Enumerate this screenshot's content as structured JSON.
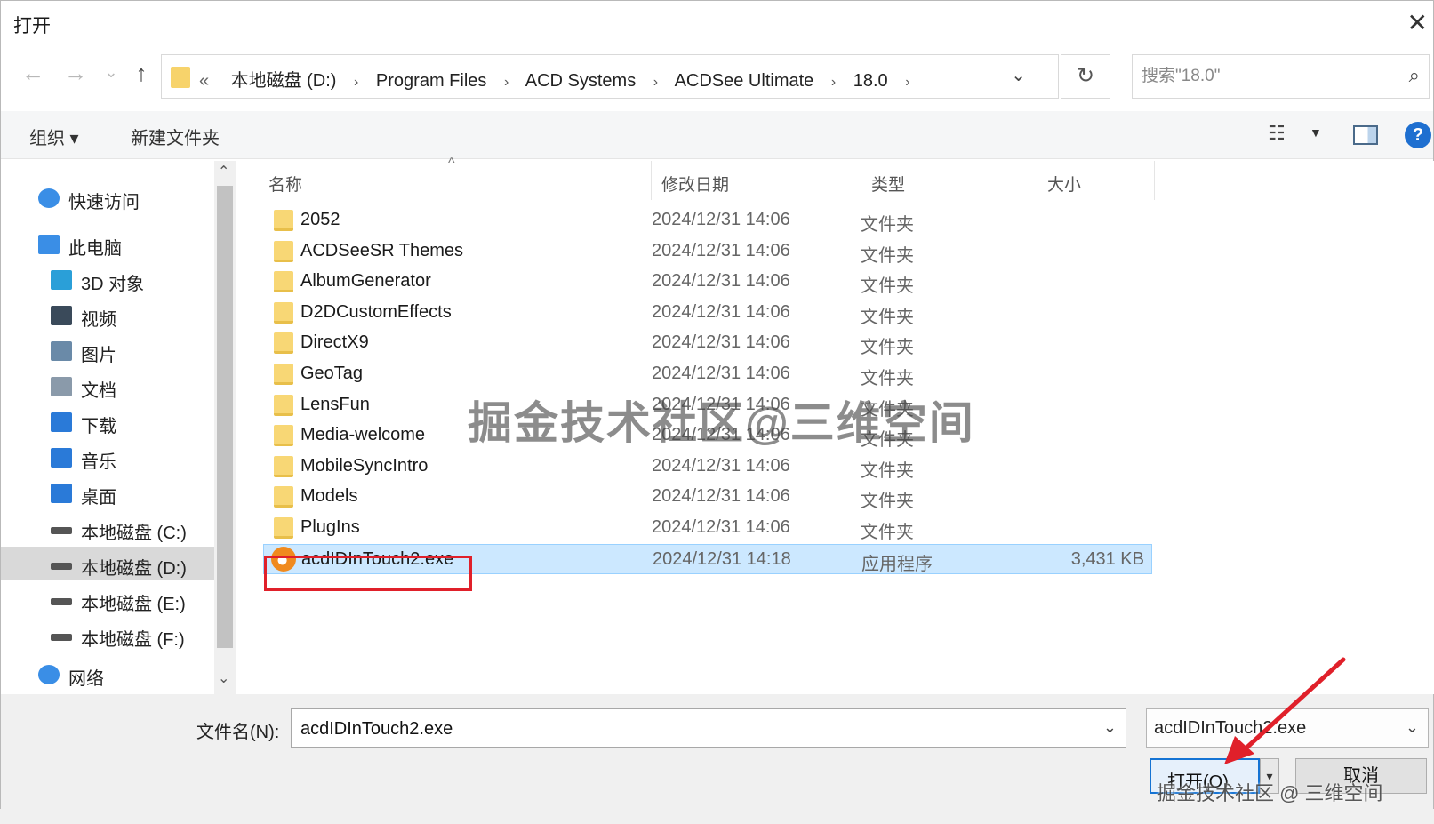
{
  "window": {
    "title": "打开",
    "close_glyph": "✕"
  },
  "nav": {
    "back": "←",
    "forward": "→",
    "recent": "⌄",
    "up": "↑",
    "refresh": "↻"
  },
  "address": {
    "overflow": "«",
    "crumbs": [
      "本地磁盘 (D:)",
      "Program Files",
      "ACD Systems",
      "ACDSee Ultimate",
      "18.0"
    ],
    "separator": "›",
    "dropdown": "⌄"
  },
  "search": {
    "placeholder": "搜索\"18.0\"",
    "icon": "⌕"
  },
  "toolbar": {
    "organize": "组织 ▾",
    "new_folder": "新建文件夹",
    "view_icon": "☷",
    "view_caret": "▼",
    "help": "?"
  },
  "sidebar": {
    "items": [
      {
        "label": "快速访问",
        "icon": "star-icon",
        "color": "#3a8ee6"
      },
      {
        "label": "此电脑",
        "icon": "computer-icon",
        "color": "#3a8ee6"
      },
      {
        "label": "3D 对象",
        "icon": "cube-icon",
        "color": "#2a9fd8"
      },
      {
        "label": "视频",
        "icon": "video-icon",
        "color": "#3a4a5a"
      },
      {
        "label": "图片",
        "icon": "picture-icon",
        "color": "#6a8aa8"
      },
      {
        "label": "文档",
        "icon": "document-icon",
        "color": "#8a9aaa"
      },
      {
        "label": "下载",
        "icon": "download-icon",
        "color": "#2a7ad8"
      },
      {
        "label": "音乐",
        "icon": "music-icon",
        "color": "#2a7ad8"
      },
      {
        "label": "桌面",
        "icon": "desktop-icon",
        "color": "#2a7ad8"
      },
      {
        "label": "本地磁盘 (C:)",
        "icon": "drive-icon",
        "color": "#555555"
      },
      {
        "label": "本地磁盘 (D:)",
        "icon": "drive-icon",
        "color": "#555555",
        "selected": true
      },
      {
        "label": "本地磁盘 (E:)",
        "icon": "drive-icon",
        "color": "#555555"
      },
      {
        "label": "本地磁盘 (F:)",
        "icon": "drive-icon",
        "color": "#555555"
      },
      {
        "label": "网络",
        "icon": "network-icon",
        "color": "#3a8ee6"
      }
    ],
    "scroll_up": "⌃",
    "scroll_down": "⌄"
  },
  "columns": {
    "name": "名称",
    "modified": "修改日期",
    "type": "类型",
    "size": "大小",
    "sort_glyph": "^"
  },
  "files": [
    {
      "name": "2052",
      "date": "2024/12/31 14:06",
      "type": "文件夹",
      "size": ""
    },
    {
      "name": "ACDSeeSR Themes",
      "date": "2024/12/31 14:06",
      "type": "文件夹",
      "size": ""
    },
    {
      "name": "AlbumGenerator",
      "date": "2024/12/31 14:06",
      "type": "文件夹",
      "size": ""
    },
    {
      "name": "D2DCustomEffects",
      "date": "2024/12/31 14:06",
      "type": "文件夹",
      "size": ""
    },
    {
      "name": "DirectX9",
      "date": "2024/12/31 14:06",
      "type": "文件夹",
      "size": ""
    },
    {
      "name": "GeoTag",
      "date": "2024/12/31 14:06",
      "type": "文件夹",
      "size": ""
    },
    {
      "name": "LensFun",
      "date": "2024/12/31 14:06",
      "type": "文件夹",
      "size": ""
    },
    {
      "name": "Media-welcome",
      "date": "2024/12/31 14:06",
      "type": "文件夹",
      "size": ""
    },
    {
      "name": "MobileSyncIntro",
      "date": "2024/12/31 14:06",
      "type": "文件夹",
      "size": ""
    },
    {
      "name": "Models",
      "date": "2024/12/31 14:06",
      "type": "文件夹",
      "size": ""
    },
    {
      "name": "PlugIns",
      "date": "2024/12/31 14:06",
      "type": "文件夹",
      "size": ""
    },
    {
      "name": "acdIDInTouch2.exe",
      "date": "2024/12/31 14:18",
      "type": "应用程序",
      "size": "3,431 KB",
      "selected": true
    }
  ],
  "bottom": {
    "filename_label": "文件名(N):",
    "filename_value": "acdIDInTouch2.exe",
    "filename_caret": "⌄",
    "filter_value": "acdIDInTouch2.exe",
    "filter_caret": "⌄",
    "open_label": "打开(O)",
    "open_split": "▾",
    "cancel_label": "取消"
  },
  "annotations": {
    "watermark": "掘金技术社区@三维空间",
    "watermark_small": "掘金技术社区 @ 三维空间",
    "highlight_color": "#e0202a",
    "arrow_color": "#e0202a"
  },
  "colors": {
    "accent": "#1573d3",
    "selection": "#cce8ff",
    "folder": "#f8d775"
  }
}
